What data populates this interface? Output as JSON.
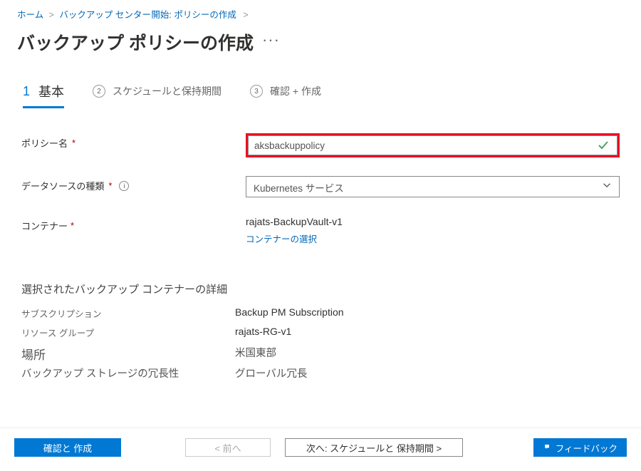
{
  "breadcrumb": {
    "home": "ホーム",
    "backup_center": "バックアップ センター",
    "start": "開始: ポリシーの作成"
  },
  "page_title": "バックアップ ポリシーの作成",
  "tabs": {
    "step1_num": "1",
    "step1_label": "基本",
    "step2_num": "2",
    "step2_label": "スケジュールと保持期間",
    "step3_num": "3",
    "step3_label": "確認 + 作成"
  },
  "form": {
    "policy_name_label": "ポリシー名",
    "policy_name_value": "aksbackuppolicy",
    "datasource_label": "データソースの種類",
    "datasource_value": "Kubernetes サービス",
    "container_label": "コンテナー",
    "container_value": "rajats-BackupVault-v1",
    "select_container_link": "コンテナーの選択"
  },
  "details": {
    "section_title": "選択されたバックアップ コンテナーの詳細",
    "subscription_label": "サブスクリプション",
    "subscription_value": "Backup PM Subscription",
    "rg_label": "リソース グループ",
    "rg_value": "rajats-RG-v1",
    "location_label": "場所",
    "location_value": "米国東部",
    "redundancy_label": "バックアップ ストレージの冗長性",
    "redundancy_value": "グローバル冗長"
  },
  "footer": {
    "review_create": "確認と 作成",
    "prev": "< 前へ",
    "next": "次へ: スケジュールと 保持期間 >",
    "feedback": "フィードバック"
  }
}
